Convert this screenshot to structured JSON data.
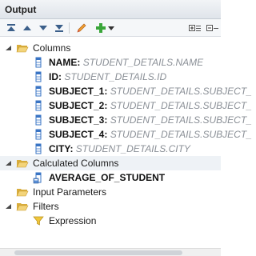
{
  "panel": {
    "title": "Output"
  },
  "toolbar": {
    "buttons": [
      {
        "name": "move-top-button",
        "icon": "double-up-icon"
      },
      {
        "name": "move-up-button",
        "icon": "up-arrow-icon"
      },
      {
        "name": "move-down-button",
        "icon": "down-arrow-icon"
      },
      {
        "name": "move-bottom-button",
        "icon": "double-down-icon"
      },
      {
        "name": "edit-button",
        "icon": "pencil-icon"
      },
      {
        "name": "add-button",
        "icon": "plus-icon"
      },
      {
        "name": "add-dropdown-button",
        "icon": "chevron-down-icon"
      },
      {
        "name": "expand-all-button",
        "icon": "expand-all-icon"
      },
      {
        "name": "collapse-all-button",
        "icon": "collapse-all-icon"
      }
    ]
  },
  "tree": {
    "columns": {
      "label": "Columns",
      "items": [
        {
          "name": "NAME",
          "source": "STUDENT_DETAILS.NAME"
        },
        {
          "name": "ID",
          "source": "STUDENT_DETAILS.ID"
        },
        {
          "name": "SUBJECT_1",
          "source": "STUDENT_DETAILS.SUBJECT_"
        },
        {
          "name": "SUBJECT_2",
          "source": "STUDENT_DETAILS.SUBJECT_"
        },
        {
          "name": "SUBJECT_3",
          "source": "STUDENT_DETAILS.SUBJECT_"
        },
        {
          "name": "SUBJECT_4",
          "source": "STUDENT_DETAILS.SUBJECT_"
        },
        {
          "name": "CITY",
          "source": "STUDENT_DETAILS.CITY"
        }
      ]
    },
    "calculated_columns": {
      "label": "Calculated Columns",
      "items": [
        {
          "name": "AVERAGE_OF_STUDENT"
        }
      ]
    },
    "input_parameters": {
      "label": "Input Parameters"
    },
    "filters": {
      "label": "Filters",
      "items": [
        {
          "name": "Expression"
        }
      ]
    }
  },
  "colors": {
    "folder": "#e8c25c",
    "column_icon": "#3a74c4",
    "filter_icon": "#e2b93b",
    "plus": "#3aa63a"
  }
}
